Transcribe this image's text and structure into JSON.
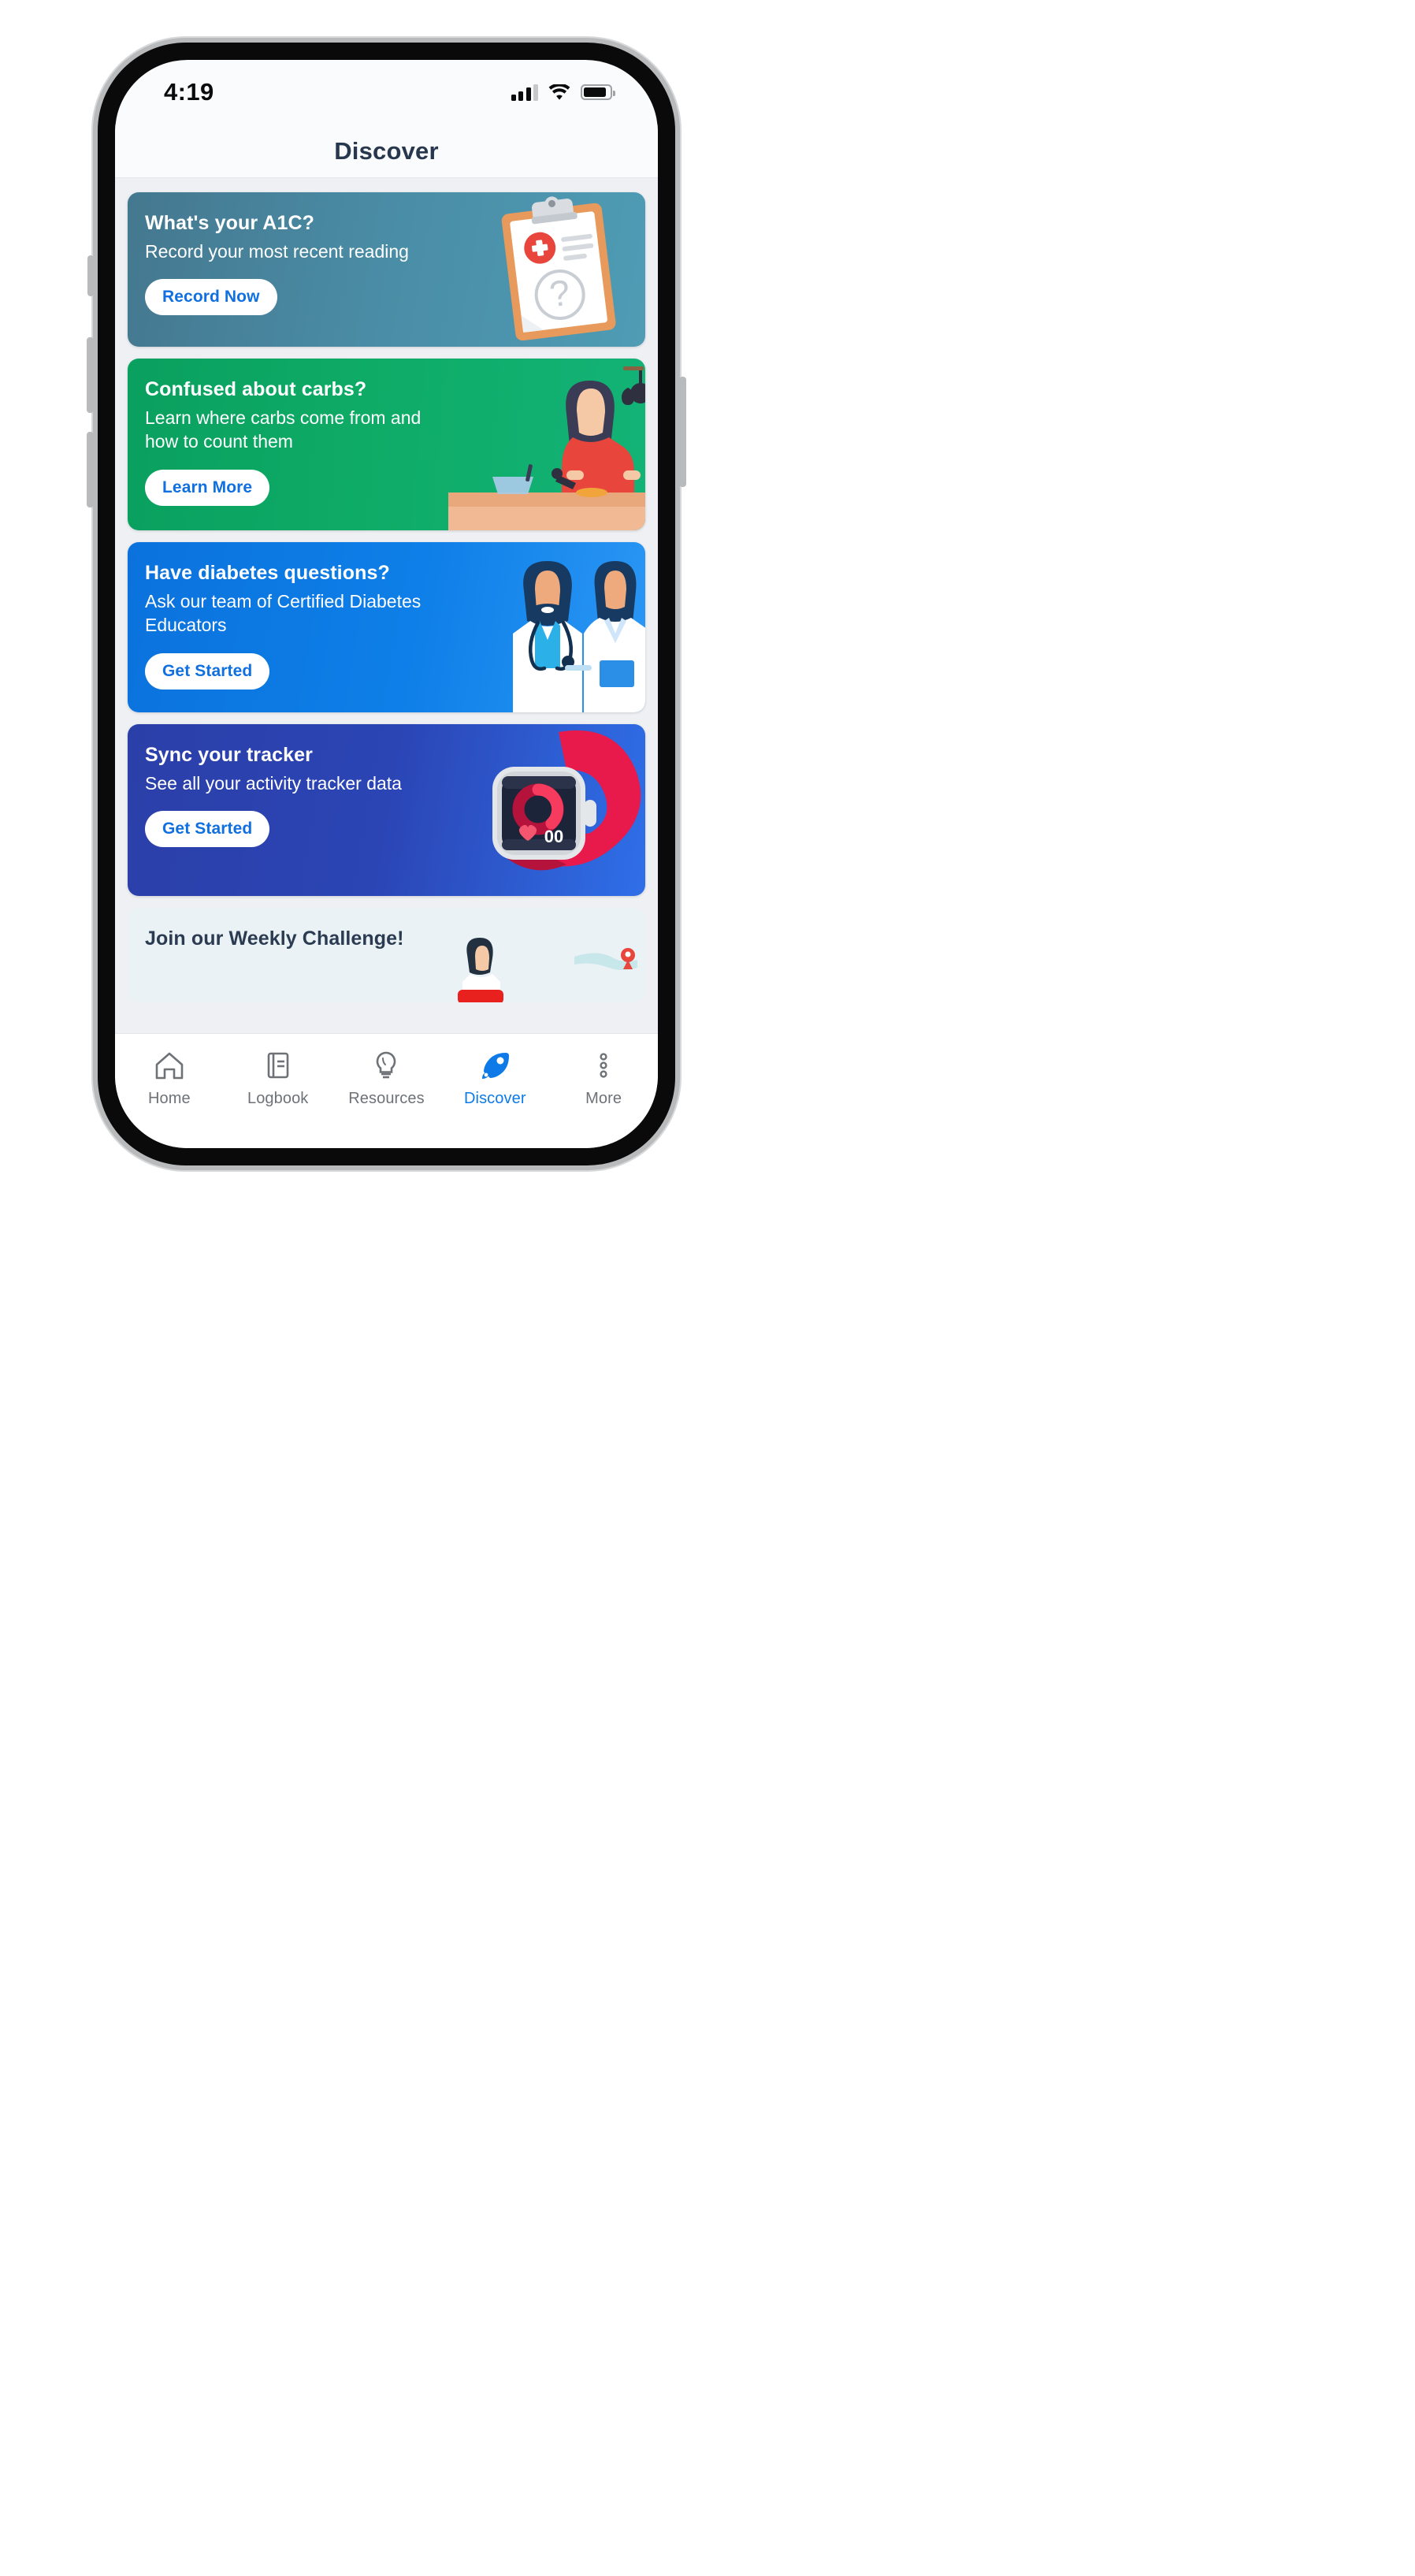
{
  "status_bar": {
    "time": "4:19",
    "signal_icon": "cellular-signal-icon",
    "wifi_icon": "wifi-icon",
    "battery_icon": "battery-icon",
    "signal_bars_total": 4,
    "signal_bars_filled": 3,
    "battery_level_pct": 88
  },
  "header": {
    "title": "Discover"
  },
  "cards": [
    {
      "id": "a1c",
      "title": "What's your A1C?",
      "subtitle": "Record your most recent reading",
      "button": "Record Now",
      "art": "clipboard-medical-icon",
      "bg_color": "#4a8ca5",
      "button_text_color": "#1070e0"
    },
    {
      "id": "carbs",
      "title": "Confused about carbs?",
      "subtitle": "Learn where carbs come from and how to count them",
      "button": "Learn More",
      "art": "woman-cooking-icon",
      "bg_color": "#0eab66",
      "button_text_color": "#1070e0"
    },
    {
      "id": "educators",
      "title": "Have diabetes questions?",
      "subtitle": "Ask our team of Certified Diabetes Educators",
      "button": "Get Started",
      "art": "two-doctors-icon",
      "bg_color": "#0e7fe8",
      "button_text_color": "#1070e0"
    },
    {
      "id": "tracker",
      "title": "Sync your tracker",
      "subtitle": "See all your activity tracker data",
      "button": "Get Started",
      "art": "smartwatch-icon",
      "bg_color": "#2b45b5",
      "button_text_color": "#1070e0"
    },
    {
      "id": "challenge",
      "title": "Join our Weekly Challenge!",
      "subtitle": "",
      "button": "",
      "art": "runner-illustration-icon",
      "bg_color": "#eaf2f5",
      "button_text_color": "#1070e0"
    }
  ],
  "watch_face": {
    "counter": "00"
  },
  "tab_bar": {
    "active_color": "#0d7ae8",
    "inactive_color": "#6e7277",
    "items": [
      {
        "label": "Home",
        "icon": "home-icon",
        "active": false
      },
      {
        "label": "Logbook",
        "icon": "book-icon",
        "active": false
      },
      {
        "label": "Resources",
        "icon": "lightbulb-icon",
        "active": false
      },
      {
        "label": "Discover",
        "icon": "rocket-icon",
        "active": true
      },
      {
        "label": "More",
        "icon": "more-dots-icon",
        "active": false
      }
    ]
  }
}
